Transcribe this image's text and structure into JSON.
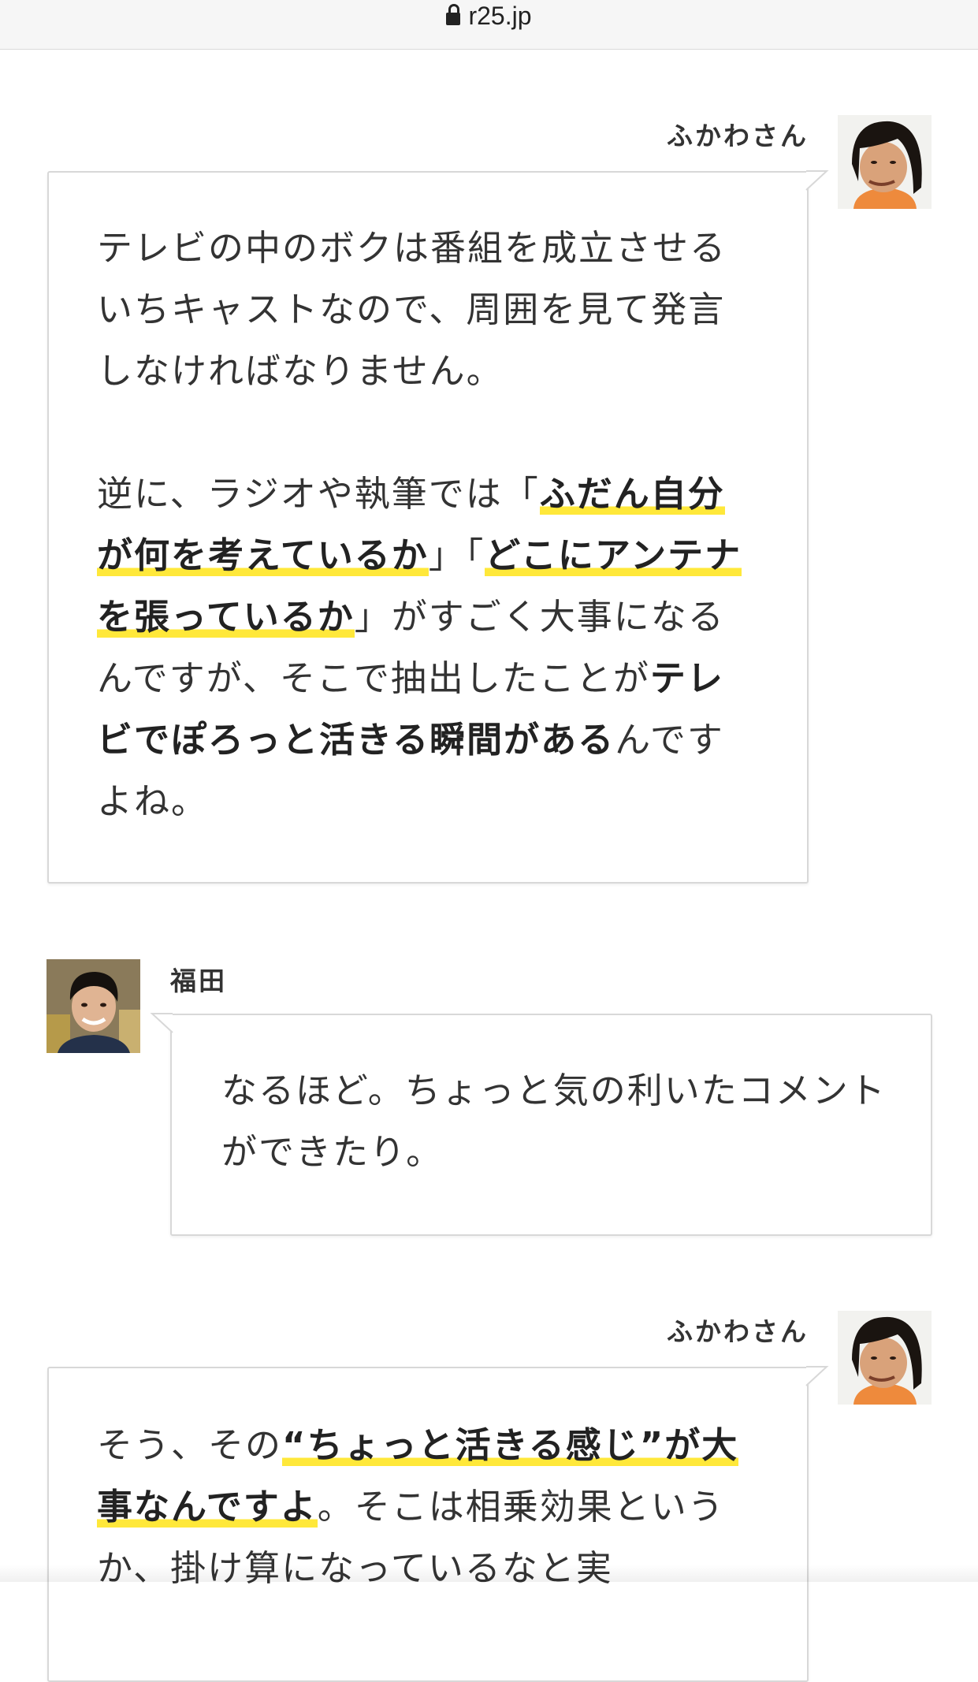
{
  "browser": {
    "url": "r25.jp",
    "lock_icon": "lock-icon"
  },
  "dialogue": [
    {
      "speaker": "ふかわさん",
      "side": "right",
      "paragraphs": [
        [
          {
            "t": "テレビの中のボクは番組を成立させるいちキャストなので、周囲を見て発言しなければなりません。",
            "s": "plain"
          }
        ],
        [
          {
            "t": "逆に、ラジオや執筆では「",
            "s": "plain"
          },
          {
            "t": "ふだん自分が何を考えているか",
            "s": "highlight"
          },
          {
            "t": "」「",
            "s": "plain"
          },
          {
            "t": "どこにアンテナを張っているか",
            "s": "highlight"
          },
          {
            "t": "」がすごく大事になるんですが、そこで抽出したことが",
            "s": "plain"
          },
          {
            "t": "テレビでぽろっと活きる瞬間がある",
            "s": "bold"
          },
          {
            "t": "んですよね。",
            "s": "plain"
          }
        ]
      ]
    },
    {
      "speaker": "福田",
      "side": "left",
      "paragraphs": [
        [
          {
            "t": "なるほど。ちょっと気の利いたコメントができたり。",
            "s": "plain"
          }
        ]
      ]
    },
    {
      "speaker": "ふかわさん",
      "side": "right",
      "paragraphs": [
        [
          {
            "t": "そう、その",
            "s": "plain"
          },
          {
            "t": "“ちょっと活きる感じ”が大事なんですよ",
            "s": "highlight"
          },
          {
            "t": "。そこは相乗効果というか、掛け算になっているなと実",
            "s": "plain"
          }
        ]
      ]
    }
  ],
  "colors": {
    "highlight": "#ffe83a",
    "border": "#d8d8d8",
    "text": "#333333"
  }
}
